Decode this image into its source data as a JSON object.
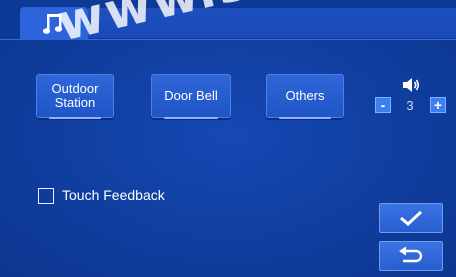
{
  "tabs": [
    {
      "icon": "music-note-icon",
      "active": true
    }
  ],
  "ring_modes": [
    {
      "label": "Outdoor Station"
    },
    {
      "label": "Door Bell"
    },
    {
      "label": "Others"
    }
  ],
  "volume": {
    "icon": "speaker-icon",
    "minus_label": "-",
    "plus_label": "+",
    "value": "3"
  },
  "touch_feedback": {
    "label": "Touch Feedback",
    "checked": false
  },
  "actions": {
    "confirm_icon": "checkmark-icon",
    "back_icon": "return-arrow-icon"
  },
  "watermark": "www.simar",
  "colors": {
    "background": "#0e3a94",
    "button": "#2f66d8",
    "accent": "#3b7ef0"
  }
}
